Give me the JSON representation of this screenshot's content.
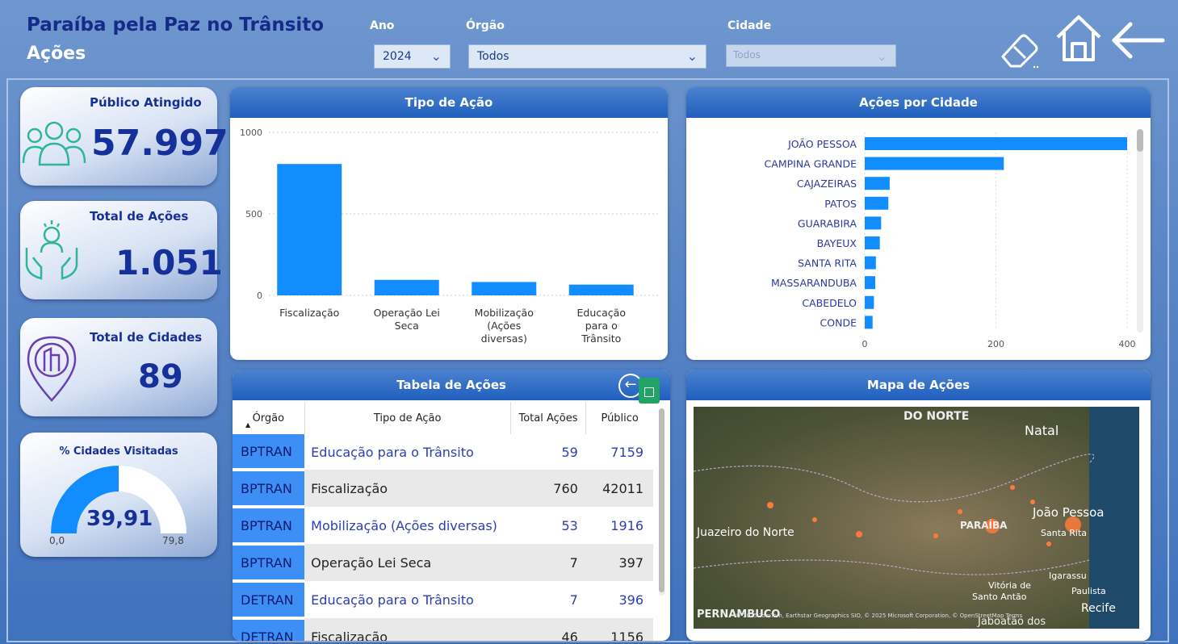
{
  "header": {
    "title": "Paraíba pela Paz no Trânsito",
    "subtitle": "Ações",
    "filters": {
      "ano_label": "Ano",
      "ano_value": "2024",
      "orgao_label": "Órgão",
      "orgao_value": "Todos",
      "cidade_label": "Cidade",
      "cidade_value": "Todos"
    }
  },
  "kpis": {
    "publico": {
      "label": "Público Atingido",
      "value": "57.997"
    },
    "acoes": {
      "label": "Total de Ações",
      "value": "1.051"
    },
    "cidades": {
      "label": "Total de Cidades",
      "value": "89"
    },
    "gauge": {
      "label": "% Cidades Visitadas",
      "value": "39,91",
      "min": "0,0",
      "max": "79,8",
      "fill": 0.5
    }
  },
  "chart_data": [
    {
      "type": "bar",
      "title": "Tipo de Ação",
      "categories": [
        "Fiscalização",
        "Operação Lei Seca",
        "Mobilização (Ações diversas)",
        "Educação para o Trânsito"
      ],
      "category_lines": [
        [
          "Fiscalização"
        ],
        [
          "Operação Lei",
          "Seca"
        ],
        [
          "Mobilização",
          "(Ações",
          "diversas)"
        ],
        [
          "Educação",
          "para o",
          "Trânsito"
        ]
      ],
      "values": [
        806,
        95,
        82,
        66
      ],
      "ylim": [
        0,
        1000
      ],
      "yticks": [
        "0",
        "500",
        "1000"
      ],
      "grid": true
    },
    {
      "type": "bar",
      "orientation": "horizontal",
      "title": "Ações por Cidade",
      "categories": [
        "JOÃO PESSOA",
        "CAMPINA GRANDE",
        "CAJAZEIRAS",
        "PATOS",
        "GUARABIRA",
        "BAYEUX",
        "SANTA RITA",
        "MASSARANDUBA",
        "CABEDELO",
        "CONDE"
      ],
      "values": [
        400,
        212,
        38,
        36,
        25,
        23,
        17,
        16,
        14,
        12
      ],
      "xlim": [
        0,
        400
      ],
      "xticks": [
        "0",
        "200",
        "400"
      ]
    }
  ],
  "table": {
    "title": "Tabela de Ações",
    "columns": [
      "Órgão",
      "Tipo de Ação",
      "Total Ações",
      "Público"
    ],
    "rows": [
      [
        "BPTRAN",
        "Educação para o Trânsito",
        "59",
        "7159"
      ],
      [
        "BPTRAN",
        "Fiscalização",
        "760",
        "42011"
      ],
      [
        "BPTRAN",
        "Mobilização (Ações diversas)",
        "53",
        "1916"
      ],
      [
        "BPTRAN",
        "Operação Lei Seca",
        "7",
        "397"
      ],
      [
        "DETRAN",
        "Educação para o Trânsito",
        "7",
        "396"
      ],
      [
        "DETRAN",
        "Fiscalização",
        "46",
        "1156"
      ]
    ]
  },
  "map": {
    "title": "Mapa de Ações",
    "labels": {
      "rn": "DO NORTE",
      "natal": "Natal",
      "joao_pessoa": "João Pessoa",
      "paraiba": "PARAÍBA",
      "santa_rita": "Santa Rita",
      "juazeiro": "Juazeiro do Norte",
      "igarassu": "Igarassu",
      "paulista": "Paulista",
      "vitoria": "Vitória de",
      "santo_antao": "Santo Antão",
      "recife": "Recife",
      "pernambuco": "PERNAMBUCO",
      "jaboatao": "Jaboatão dos"
    },
    "attribution": "© 2025 TomTom, Earthstar Geographics SIO, © 2025 Microsoft Corporation, © OpenStreetMap  Terms"
  },
  "icons": {
    "eraser": "eraser-icon",
    "home": "home-icon",
    "back": "back-arrow-icon",
    "people": "people-icon",
    "hands": "hands-icon",
    "city": "city-pin-icon"
  },
  "colors": {
    "bar": "#118dff",
    "header": "#1f5fbd",
    "orgao_cell": "#3d8ef5"
  }
}
